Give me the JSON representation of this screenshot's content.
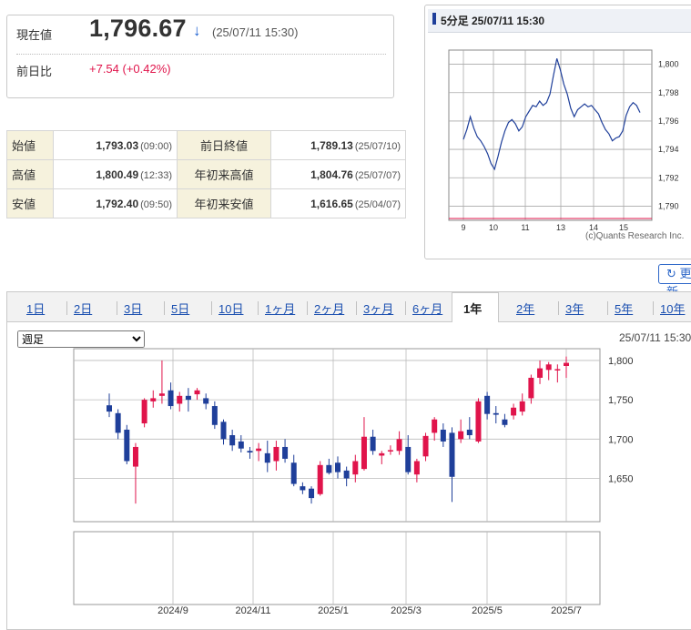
{
  "quote": {
    "price_label": "現在値",
    "price": "1,796.67",
    "arrow": "↓",
    "price_time": "(25/07/11 15:30)",
    "change_label": "前日比",
    "change": "+7.54 (+0.42%)",
    "down_color": "#1a5fd0",
    "up_color": "#e0144b"
  },
  "stats": [
    {
      "label": "始値",
      "value": "1,793.03",
      "time": "(09:00)",
      "label2": "前日終値",
      "value2": "1,789.13",
      "time2": "(25/07/10)"
    },
    {
      "label": "高値",
      "value": "1,800.49",
      "time": "(12:33)",
      "label2": "年初来高値",
      "value2": "1,804.76",
      "time2": "(25/07/07)"
    },
    {
      "label": "安値",
      "value": "1,792.40",
      "time": "(09:50)",
      "label2": "年初来安値",
      "value2": "1,616.65",
      "time2": "(25/04/07)"
    }
  ],
  "intraday": {
    "title": "5分足 25/07/11 15:30",
    "credit": "(c)Quants Research Inc.",
    "line_color": "#1f3f9a",
    "prev_close_color": "#e0144b",
    "chart_data": {
      "type": "line",
      "x_ticks": [
        "9",
        "10",
        "11",
        "13",
        "14",
        "15"
      ],
      "y_ticks": [
        "1,800",
        "1,798",
        "1,796",
        "1,794",
        "1,792",
        "1,790"
      ],
      "ylim": [
        1789,
        1801
      ],
      "prev_close": 1789.13,
      "series": [
        {
          "values": [
            1794.7,
            1795.4,
            1796.3,
            1795.5,
            1794.9,
            1794.6,
            1794.2,
            1793.7,
            1793.0,
            1792.6,
            1793.5,
            1794.5,
            1795.3,
            1795.9,
            1796.1,
            1795.8,
            1795.3,
            1795.6,
            1796.3,
            1796.7,
            1797.1,
            1797.0,
            1797.4,
            1797.1,
            1797.3,
            1797.9,
            1799.2,
            1800.4,
            1799.6,
            1798.6,
            1797.9,
            1796.9,
            1796.3,
            1796.8,
            1797.0,
            1797.2,
            1797.0,
            1797.1,
            1796.8,
            1796.5,
            1795.9,
            1795.4,
            1795.1,
            1794.6,
            1794.8,
            1794.9,
            1795.3,
            1796.4,
            1797.0,
            1797.3,
            1797.1,
            1796.6
          ]
        }
      ]
    }
  },
  "refresh_label": "更新",
  "tabs": [
    "1日",
    "2日",
    "3日",
    "5日",
    "10日",
    "1ヶ月",
    "2ヶ月",
    "3ヶ月",
    "6ヶ月",
    "1年",
    "2年",
    "3年",
    "5年",
    "10年"
  ],
  "active_tab": "1年",
  "period_select": {
    "selected": "週足"
  },
  "chart_date": "25/07/11 15:30",
  "main_chart": {
    "chart_data": {
      "type": "candlestick",
      "x_ticks": [
        "2024/9",
        "2024/11",
        "2025/1",
        "2025/3",
        "2025/5",
        "2025/7"
      ],
      "y_ticks": [
        "1,800",
        "1,750",
        "1,700",
        "1,650"
      ],
      "ylim": [
        1595,
        1815
      ],
      "up_color": "#e0144b",
      "down_color": "#1f3f9a",
      "candles": [
        {
          "o": 1743,
          "h": 1758,
          "l": 1728,
          "c": 1735
        },
        {
          "o": 1733,
          "h": 1738,
          "l": 1700,
          "c": 1708
        },
        {
          "o": 1712,
          "h": 1718,
          "l": 1668,
          "c": 1672
        },
        {
          "o": 1665,
          "h": 1695,
          "l": 1618,
          "c": 1690
        },
        {
          "o": 1720,
          "h": 1752,
          "l": 1715,
          "c": 1750
        },
        {
          "o": 1748,
          "h": 1762,
          "l": 1740,
          "c": 1752
        },
        {
          "o": 1755,
          "h": 1800,
          "l": 1745,
          "c": 1758
        },
        {
          "o": 1762,
          "h": 1772,
          "l": 1738,
          "c": 1742
        },
        {
          "o": 1745,
          "h": 1760,
          "l": 1735,
          "c": 1755
        },
        {
          "o": 1755,
          "h": 1765,
          "l": 1735,
          "c": 1750
        },
        {
          "o": 1757,
          "h": 1765,
          "l": 1750,
          "c": 1762
        },
        {
          "o": 1752,
          "h": 1758,
          "l": 1738,
          "c": 1745
        },
        {
          "o": 1742,
          "h": 1748,
          "l": 1713,
          "c": 1718
        },
        {
          "o": 1722,
          "h": 1725,
          "l": 1693,
          "c": 1700
        },
        {
          "o": 1705,
          "h": 1712,
          "l": 1685,
          "c": 1692
        },
        {
          "o": 1697,
          "h": 1705,
          "l": 1683,
          "c": 1688
        },
        {
          "o": 1685,
          "h": 1690,
          "l": 1675,
          "c": 1683
        },
        {
          "o": 1685,
          "h": 1695,
          "l": 1672,
          "c": 1688
        },
        {
          "o": 1682,
          "h": 1698,
          "l": 1658,
          "c": 1670
        },
        {
          "o": 1672,
          "h": 1698,
          "l": 1660,
          "c": 1690
        },
        {
          "o": 1690,
          "h": 1700,
          "l": 1670,
          "c": 1675
        },
        {
          "o": 1670,
          "h": 1680,
          "l": 1640,
          "c": 1643
        },
        {
          "o": 1640,
          "h": 1645,
          "l": 1630,
          "c": 1635
        },
        {
          "o": 1637,
          "h": 1640,
          "l": 1618,
          "c": 1625
        },
        {
          "o": 1630,
          "h": 1672,
          "l": 1628,
          "c": 1667
        },
        {
          "o": 1667,
          "h": 1675,
          "l": 1655,
          "c": 1657
        },
        {
          "o": 1670,
          "h": 1678,
          "l": 1650,
          "c": 1658
        },
        {
          "o": 1660,
          "h": 1665,
          "l": 1640,
          "c": 1650
        },
        {
          "o": 1655,
          "h": 1680,
          "l": 1645,
          "c": 1672
        },
        {
          "o": 1662,
          "h": 1728,
          "l": 1660,
          "c": 1703
        },
        {
          "o": 1703,
          "h": 1712,
          "l": 1680,
          "c": 1685
        },
        {
          "o": 1679,
          "h": 1685,
          "l": 1668,
          "c": 1682
        },
        {
          "o": 1685,
          "h": 1692,
          "l": 1680,
          "c": 1686
        },
        {
          "o": 1685,
          "h": 1710,
          "l": 1680,
          "c": 1700
        },
        {
          "o": 1690,
          "h": 1705,
          "l": 1655,
          "c": 1658
        },
        {
          "o": 1655,
          "h": 1675,
          "l": 1645,
          "c": 1672
        },
        {
          "o": 1678,
          "h": 1708,
          "l": 1672,
          "c": 1704
        },
        {
          "o": 1708,
          "h": 1728,
          "l": 1698,
          "c": 1725
        },
        {
          "o": 1712,
          "h": 1720,
          "l": 1690,
          "c": 1697
        },
        {
          "o": 1708,
          "h": 1715,
          "l": 1620,
          "c": 1652
        },
        {
          "o": 1700,
          "h": 1725,
          "l": 1695,
          "c": 1710
        },
        {
          "o": 1712,
          "h": 1728,
          "l": 1700,
          "c": 1705
        },
        {
          "o": 1697,
          "h": 1752,
          "l": 1695,
          "c": 1748
        },
        {
          "o": 1755,
          "h": 1760,
          "l": 1725,
          "c": 1732
        },
        {
          "o": 1733,
          "h": 1742,
          "l": 1720,
          "c": 1731
        },
        {
          "o": 1725,
          "h": 1732,
          "l": 1715,
          "c": 1718
        },
        {
          "o": 1730,
          "h": 1745,
          "l": 1725,
          "c": 1740
        },
        {
          "o": 1735,
          "h": 1758,
          "l": 1730,
          "c": 1748
        },
        {
          "o": 1752,
          "h": 1782,
          "l": 1745,
          "c": 1778
        },
        {
          "o": 1778,
          "h": 1800,
          "l": 1770,
          "c": 1790
        },
        {
          "o": 1788,
          "h": 1798,
          "l": 1775,
          "c": 1795
        },
        {
          "o": 1788,
          "h": 1795,
          "l": 1772,
          "c": 1789
        },
        {
          "o": 1793,
          "h": 1805,
          "l": 1778,
          "c": 1797
        }
      ]
    }
  }
}
